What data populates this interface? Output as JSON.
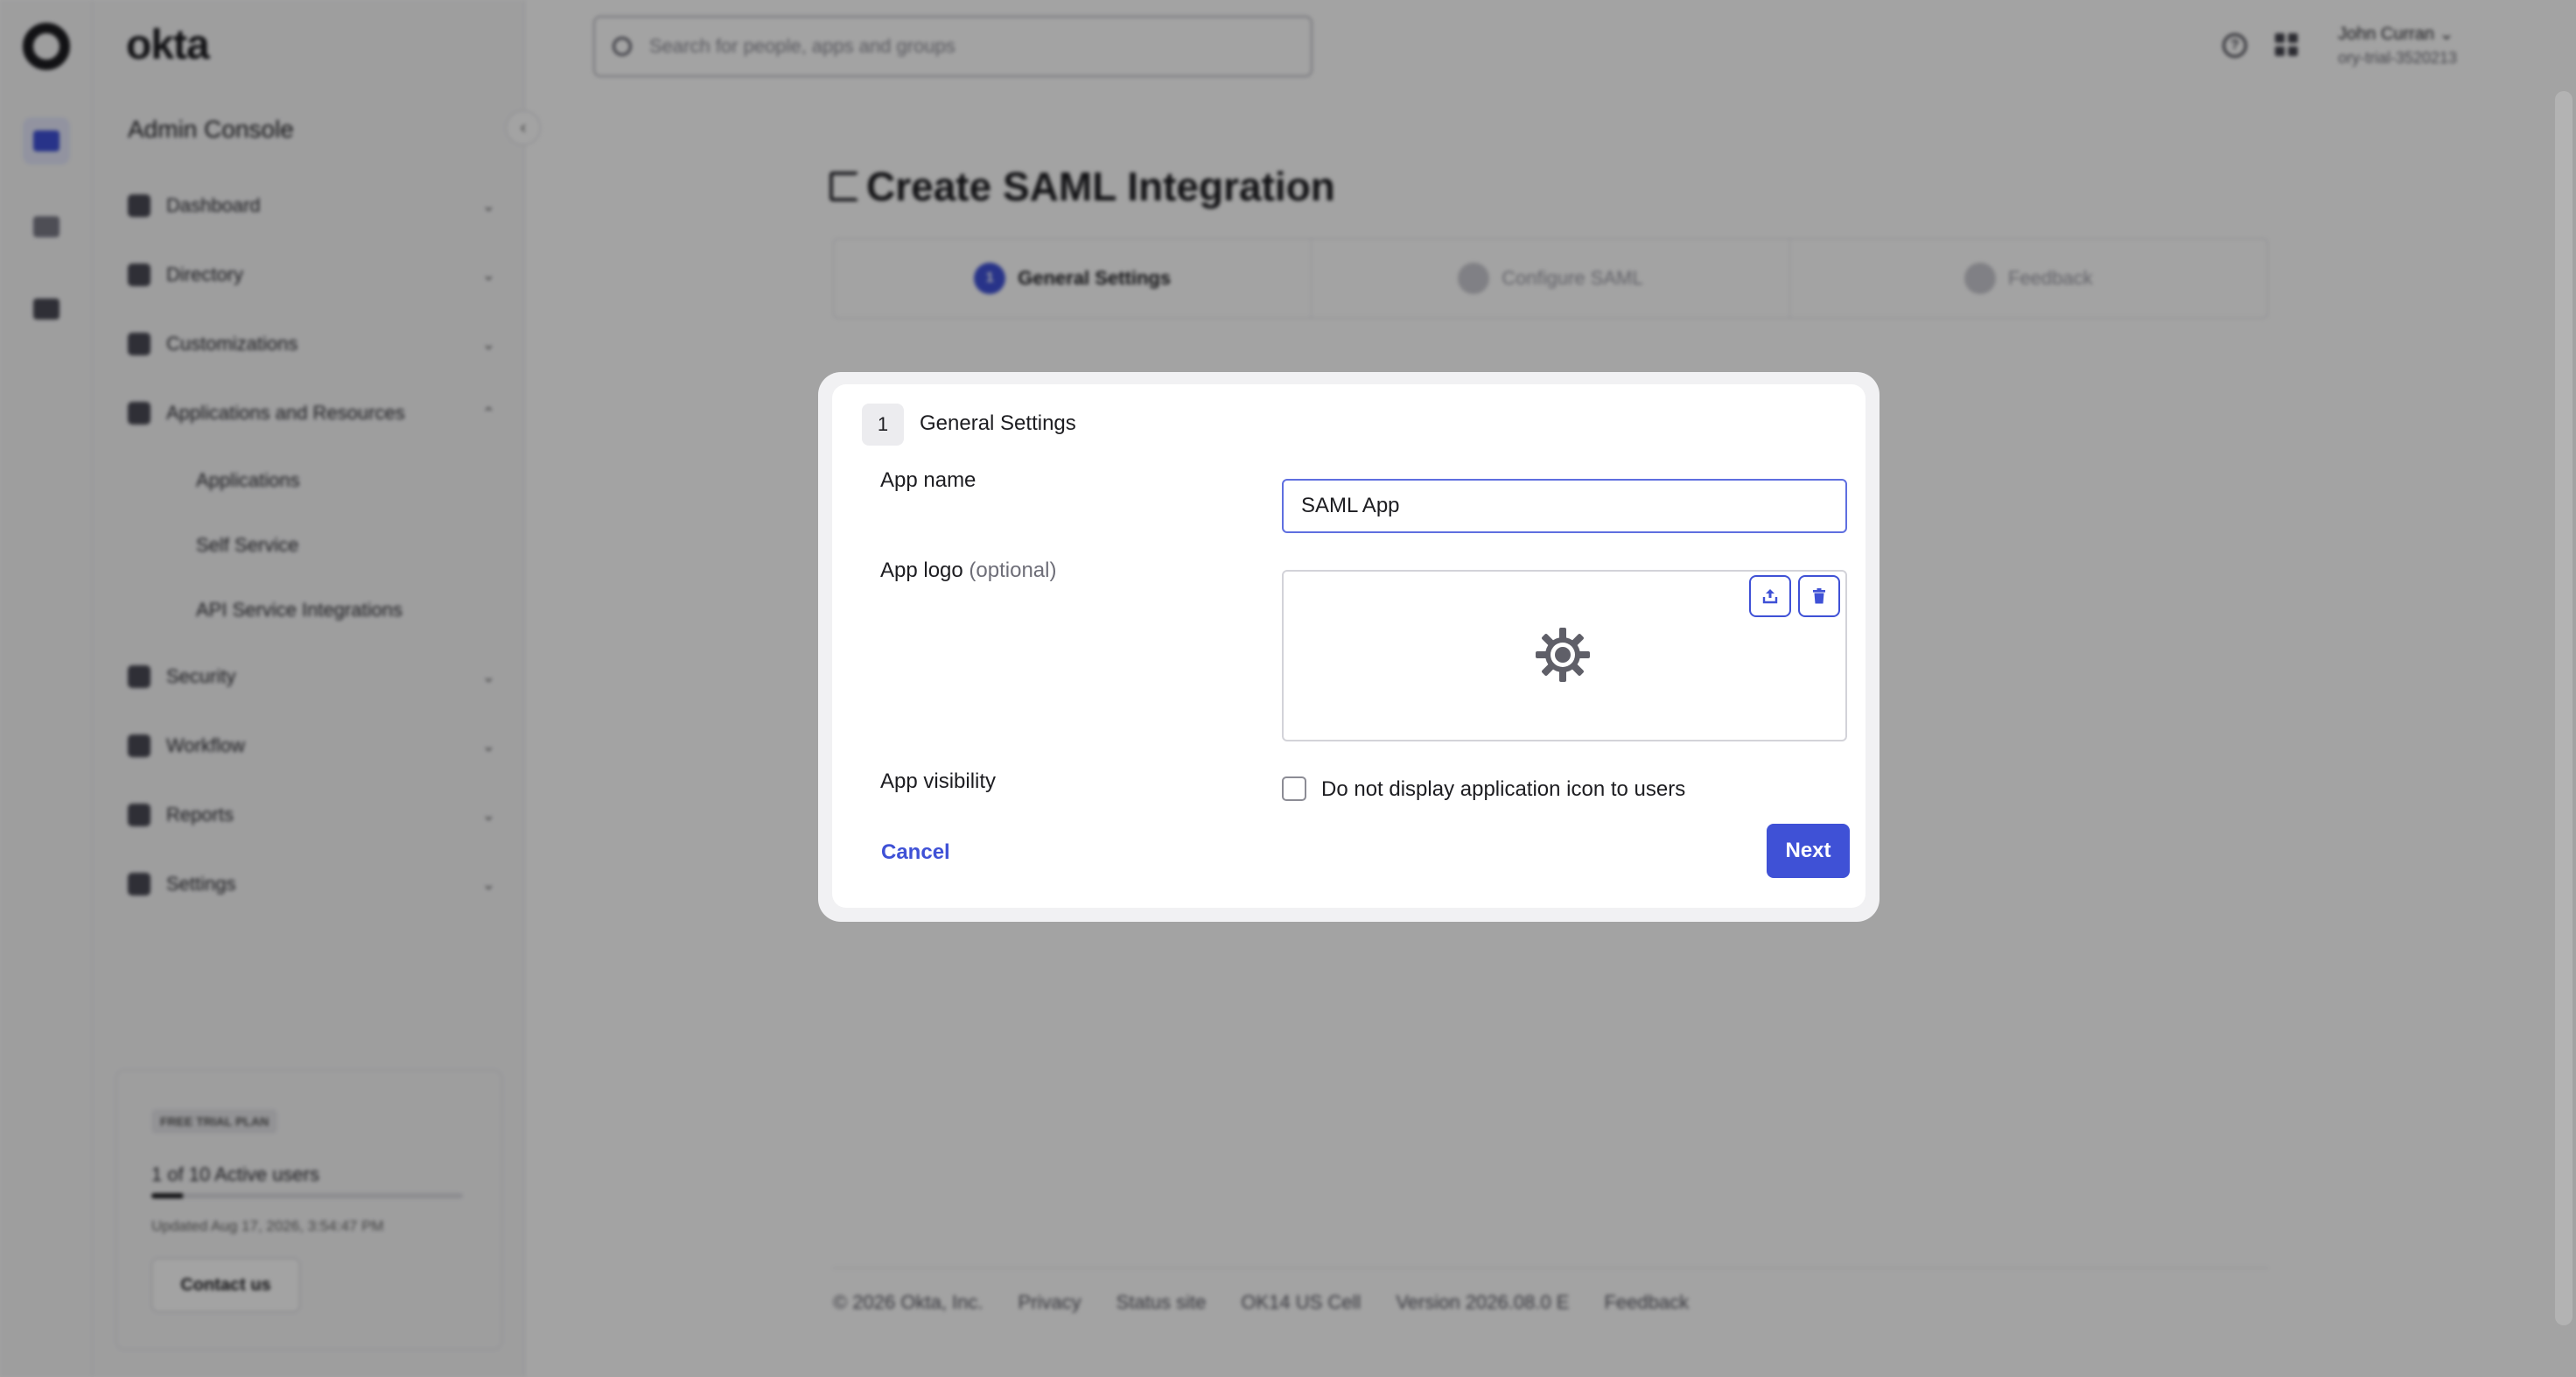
{
  "app": {
    "brand": "okta",
    "console_title": "Admin Console"
  },
  "rail": {
    "icons": [
      "okta-logo-icon",
      "admin-console-icon",
      "dashboard-grid-icon",
      "integrations-icon"
    ]
  },
  "sidebar": {
    "items": [
      {
        "label": "Dashboard",
        "icon": "home-icon",
        "expanded": false
      },
      {
        "label": "Directory",
        "icon": "directory-icon",
        "expanded": false
      },
      {
        "label": "Customizations",
        "icon": "brush-icon",
        "expanded": false
      },
      {
        "label": "Applications and Resources",
        "icon": "apps-icon",
        "expanded": true
      },
      {
        "label": "Security",
        "icon": "shield-icon",
        "expanded": false
      },
      {
        "label": "Workflow",
        "icon": "workflow-icon",
        "expanded": false
      },
      {
        "label": "Reports",
        "icon": "reports-icon",
        "expanded": false
      },
      {
        "label": "Settings",
        "icon": "gear-icon",
        "expanded": false
      }
    ],
    "subitems": [
      "Applications",
      "Self Service",
      "API Service Integrations"
    ],
    "trial": {
      "badge": "FREE TRIAL PLAN",
      "users_text": "1 of 10 Active users",
      "usage_fraction": 0.1,
      "updated": "Updated Aug 17, 2026, 3:54:47 PM",
      "contact": "Contact us"
    }
  },
  "topbar": {
    "search_placeholder": "Search for people, apps and groups",
    "user_name": "John Curran",
    "user_org": "ory-trial-3520213"
  },
  "page": {
    "title": "Create SAML Integration",
    "steps": [
      {
        "num": "1",
        "label": "General Settings",
        "active": true
      },
      {
        "num": "2",
        "label": "Configure SAML",
        "active": false
      },
      {
        "num": "3",
        "label": "Feedback",
        "active": false
      }
    ],
    "footer": [
      "© 2026 Okta, Inc.",
      "Privacy",
      "Status site",
      "OK14 US Cell",
      "Version 2026.08.0 E",
      "Feedback"
    ]
  },
  "modal": {
    "step_number": "1",
    "step_title": "General Settings",
    "app_name_label": "App name",
    "app_name_value": "SAML App",
    "app_logo_label": "App logo",
    "app_logo_optional": "(optional)",
    "visibility_label": "App visibility",
    "visibility_option": "Do not display application icon to users",
    "visibility_checked": false,
    "cancel": "Cancel",
    "next": "Next"
  },
  "colors": {
    "accent": "#3f51d6",
    "scrim": "rgba(0,0,0,0.36)"
  }
}
